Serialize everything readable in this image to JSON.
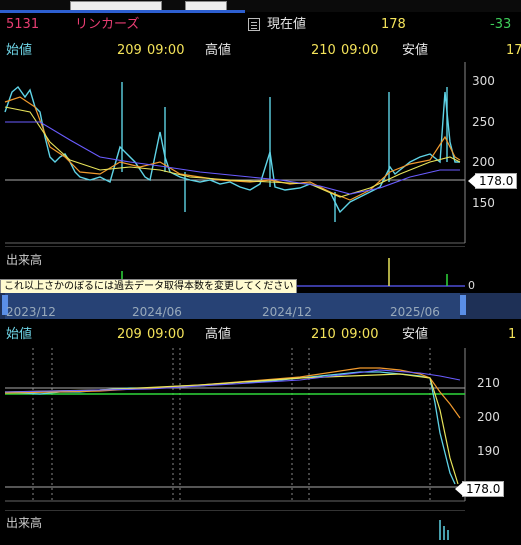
{
  "stock": {
    "code": "5131",
    "name": "リンカーズ"
  },
  "labels": {
    "current": "現在値",
    "open": "始値",
    "high": "高値",
    "low": "安値",
    "volume": "出来高"
  },
  "quote": {
    "current_price": "178",
    "change": "-33",
    "open_top": "209",
    "open_top_time": "09:00",
    "high_top": "210",
    "high_top_time": "09:00",
    "low_top_partial": "17",
    "open_bottom": "209",
    "open_bottom_time": "09:00",
    "high_bottom": "210",
    "high_bottom_time": "09:00",
    "low_bottom_partial": "1"
  },
  "upper_chart": {
    "y_ticks": [
      "300",
      "250",
      "200",
      "150"
    ],
    "last_price_label": "178.0",
    "year_labels": [
      "2024",
      "2025"
    ],
    "tooltip": "これ以上さかのぼるには過去データ取得本数を変更してください",
    "volume_tick": "0"
  },
  "navigator": {
    "dates": [
      "2023/12",
      "2024/06",
      "2024/12",
      "2025/06"
    ]
  },
  "lower_chart": {
    "y_ticks": [
      "210",
      "200",
      "190"
    ],
    "last_price_label": "178.0"
  },
  "colors": {
    "candle": "#5fd3e6",
    "ma_short": "#f29a2e",
    "ma_mid": "#e8e45a",
    "ma_long": "#6a5cff",
    "support": "#2fd83a",
    "background": "#000000"
  }
}
